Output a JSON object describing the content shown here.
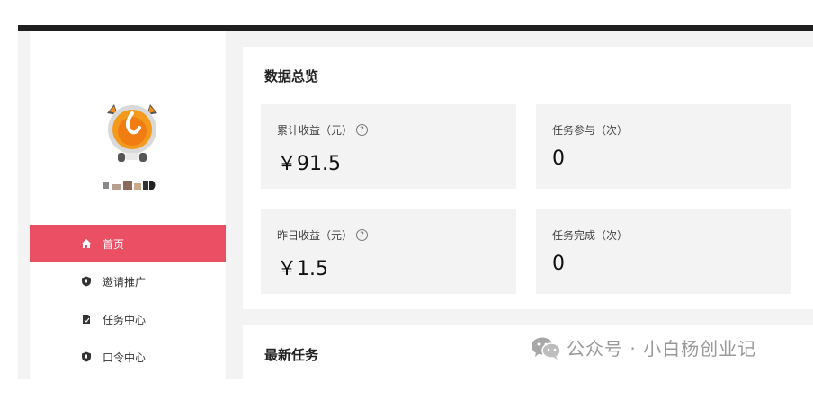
{
  "sidebar": {
    "menu": [
      {
        "label": "首页",
        "icon": "home-icon",
        "active": true
      },
      {
        "label": "邀请推广",
        "icon": "shield-icon",
        "active": false
      },
      {
        "label": "任务中心",
        "icon": "document-icon",
        "active": false
      },
      {
        "label": "口令中心",
        "icon": "shield-icon",
        "active": false
      }
    ]
  },
  "overview": {
    "title": "数据总览",
    "cards": [
      {
        "label": "累计收益（元）",
        "value": "￥91.5",
        "help": true
      },
      {
        "label": "任务参与（次）",
        "value": "0",
        "help": false
      },
      {
        "label": "昨日收益（元）",
        "value": "￥1.5",
        "help": true
      },
      {
        "label": "任务完成（次）",
        "value": "0",
        "help": false
      }
    ]
  },
  "tasks": {
    "title": "最新任务"
  },
  "watermark": {
    "text": "公众号 · 小白杨创业记"
  },
  "colors": {
    "active": "#ea4f64",
    "card_bg": "#f3f3f3",
    "page_bg": "#f3f3f3",
    "topbar": "#1f1f1f"
  }
}
